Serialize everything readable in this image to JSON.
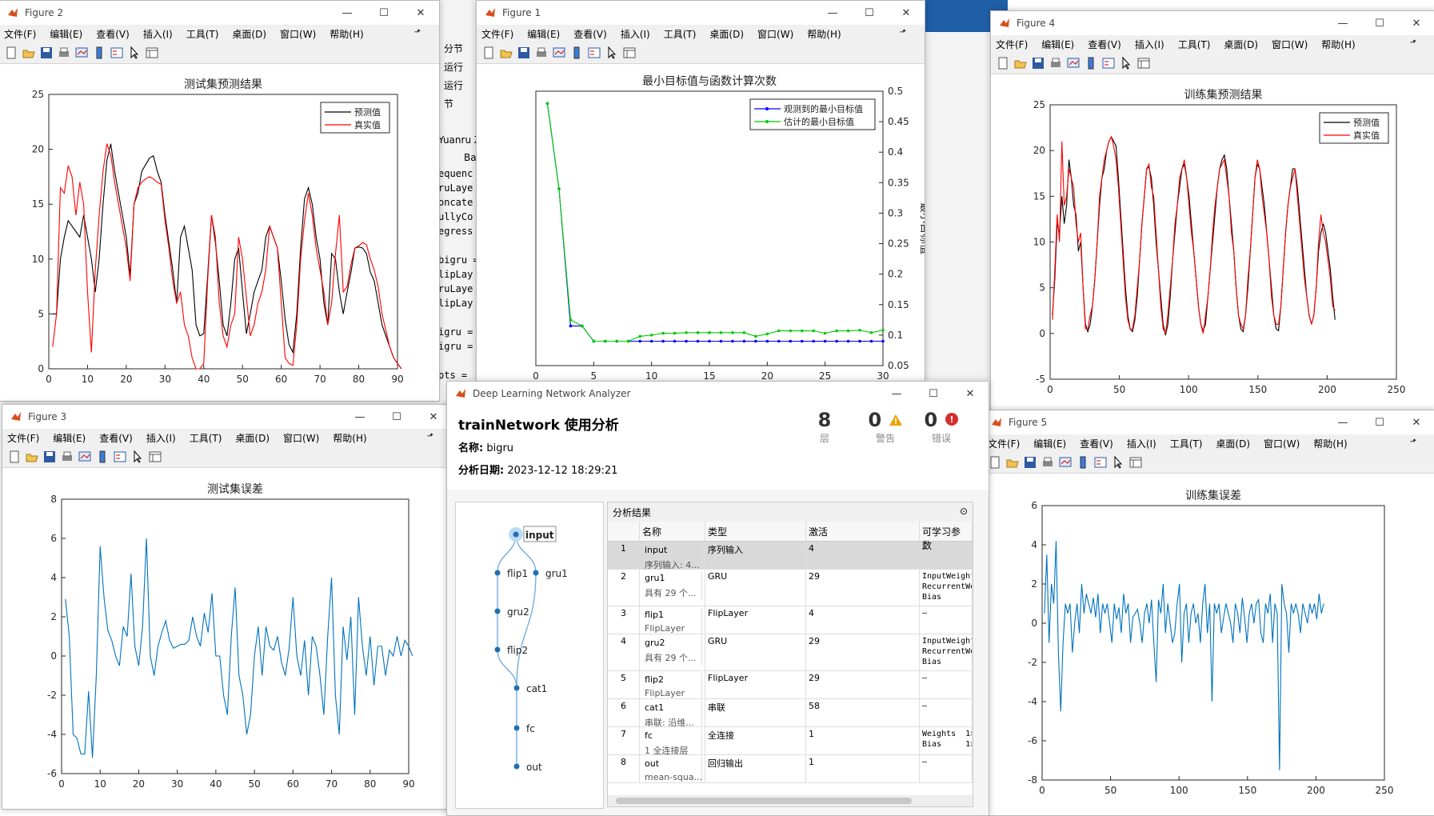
{
  "desktop": {
    "editor_side": [
      "分节",
      "运行",
      "运行",
      "节"
    ],
    "editor_tab": "Yuanru Z",
    "editor_tab2": "Ba",
    "editor_code": [
      "equenc",
      "ruLaye",
      "oncate",
      "ullyCo",
      "egress",
      "",
      "bigru =",
      "lipLay",
      "ruLaye",
      "lipLay",
      "",
      "igru =",
      "igru =",
      "",
      "pts ="
    ]
  },
  "menus": {
    "figure": [
      "文件(F)",
      "编辑(E)",
      "查看(V)",
      "插入(I)",
      "工具(T)",
      "桌面(D)",
      "窗口(W)",
      "帮助(H)"
    ]
  },
  "fig2": {
    "title": "Figure 2",
    "chart_data": {
      "type": "line",
      "title": "测试集预测结果",
      "xlim": [
        0,
        90
      ],
      "ylim": [
        0,
        25
      ],
      "xticks": [
        0,
        10,
        20,
        30,
        40,
        50,
        60,
        70,
        80,
        90
      ],
      "yticks": [
        0,
        5,
        10,
        15,
        20,
        25
      ],
      "legend": "top-right",
      "series": [
        {
          "name": "预测值",
          "color": "#000000",
          "values": [
            5,
            5,
            10,
            12,
            13.5,
            13,
            12.5,
            12,
            14,
            12,
            10,
            7,
            10,
            15,
            19,
            20.5,
            18,
            16,
            14,
            12,
            8.5,
            15,
            16,
            18,
            18.6,
            19.2,
            19.4,
            18,
            17,
            14,
            11.5,
            9,
            6,
            12,
            13,
            11,
            9,
            4,
            3,
            3.2,
            8.5,
            14,
            11.5,
            8,
            4,
            3,
            6,
            10,
            11,
            7,
            3.2,
            5,
            7,
            8,
            9,
            12,
            13,
            12,
            11,
            8,
            4.5,
            2.2,
            1.5,
            5,
            11,
            15.5,
            16.5,
            15,
            12,
            10,
            6,
            4,
            10.5,
            10,
            7,
            5,
            7,
            8.8,
            11,
            11.1,
            11,
            10.5,
            8.8,
            8,
            6,
            4,
            3,
            2,
            1,
            0.5,
            0
          ]
        },
        {
          "name": "真实值",
          "color": "#ff0000",
          "values": [
            2,
            5,
            16.5,
            16,
            18.5,
            17.5,
            14,
            17,
            15,
            7,
            1.5,
            9,
            14,
            18,
            20.5,
            19.5,
            17,
            15,
            13,
            11,
            8,
            15,
            16.5,
            17,
            17.3,
            17.5,
            17.3,
            17,
            16.8,
            13.5,
            11,
            8,
            6,
            7,
            4,
            3,
            1,
            0,
            0,
            0.5,
            8,
            14,
            12,
            6,
            3,
            2,
            4,
            5,
            12,
            10,
            6.5,
            3,
            4,
            6,
            7,
            9,
            13,
            12,
            11,
            6,
            1,
            0.5,
            0.3,
            4,
            10,
            13.5,
            16,
            14,
            11,
            9,
            7,
            4,
            6,
            10.5,
            14,
            7,
            7.5,
            9.5,
            11,
            11.2,
            11.5,
            11.3,
            10,
            9,
            7.5,
            5,
            3.5,
            2,
            1,
            0.5,
            0
          ]
        }
      ]
    }
  },
  "fig1": {
    "title": "Figure 1",
    "chart_data": {
      "type": "line",
      "title": "最小目标值与函数计算次数",
      "ylabel": "最小目标值",
      "xlim": [
        0,
        30
      ],
      "ylim": [
        0.05,
        0.5
      ],
      "xticks": [
        0,
        5,
        10,
        15,
        20,
        25,
        30
      ],
      "yticks": [
        0.05,
        0.1,
        0.15,
        0.2,
        0.25,
        0.3,
        0.35,
        0.4,
        0.45,
        0.5
      ],
      "legend": "top-right",
      "x": [
        1,
        2,
        3,
        4,
        5,
        6,
        7,
        8,
        9,
        10,
        11,
        12,
        13,
        14,
        15,
        16,
        17,
        18,
        19,
        20,
        21,
        22,
        23,
        24,
        25,
        26,
        27,
        28,
        29,
        30
      ],
      "series": [
        {
          "name": "观测到的最小目标值",
          "color": "#0000ff",
          "values": [
            0.48,
            0.34,
            0.115,
            0.115,
            0.09,
            0.09,
            0.09,
            0.09,
            0.09,
            0.09,
            0.09,
            0.09,
            0.09,
            0.09,
            0.09,
            0.09,
            0.09,
            0.09,
            0.09,
            0.09,
            0.09,
            0.09,
            0.09,
            0.09,
            0.09,
            0.09,
            0.09,
            0.09,
            0.09,
            0.09
          ]
        },
        {
          "name": "估计的最小目标值",
          "color": "#00cc00",
          "values": [
            0.48,
            0.34,
            0.125,
            0.115,
            0.09,
            0.09,
            0.09,
            0.09,
            0.098,
            0.1,
            0.103,
            0.103,
            0.104,
            0.104,
            0.104,
            0.104,
            0.104,
            0.104,
            0.098,
            0.102,
            0.107,
            0.107,
            0.107,
            0.107,
            0.103,
            0.107,
            0.107,
            0.108,
            0.104,
            0.108
          ]
        }
      ]
    }
  },
  "fig4": {
    "title": "Figure 4",
    "chart_data": {
      "type": "line",
      "title": "训练集预测结果",
      "xlim": [
        0,
        250
      ],
      "ylim": [
        -5,
        25
      ],
      "xticks": [
        0,
        50,
        100,
        150,
        200,
        250
      ],
      "yticks": [
        -5,
        0,
        5,
        10,
        15,
        20,
        25
      ],
      "legend": "top-right",
      "series": [
        {
          "name": "预测值",
          "color": "#000000",
          "values": [
            2,
            6,
            12,
            11,
            15,
            12,
            14,
            19,
            17,
            14,
            13,
            9,
            10,
            5,
            1,
            0.2,
            1,
            3,
            6,
            10,
            14,
            17,
            18,
            20,
            21,
            21.5,
            21,
            20.5,
            17,
            13,
            9,
            5,
            2,
            0.5,
            0.2,
            1.5,
            4,
            8,
            12,
            15,
            18,
            18.2,
            17,
            14,
            10,
            7,
            4,
            1,
            -0.2,
            1,
            4,
            8,
            11,
            14,
            16,
            18,
            18.5,
            17,
            15,
            12,
            9,
            6,
            3,
            1,
            0.3,
            1,
            4,
            7,
            10,
            13,
            16,
            18,
            19,
            19.5,
            18,
            15,
            12,
            9,
            5,
            2,
            0.5,
            0.2,
            2,
            5,
            9,
            13,
            17,
            18.5,
            18,
            16,
            14,
            11,
            8,
            5,
            2,
            0.5,
            0.3,
            3,
            7,
            11,
            14,
            16,
            18,
            18,
            16,
            13,
            10,
            7,
            4,
            2,
            1,
            2,
            5,
            9,
            11,
            12,
            11,
            9,
            7,
            4,
            1.5
          ]
        },
        {
          "name": "真实值",
          "color": "#ff0000",
          "values": [
            1.5,
            7,
            13,
            10,
            21,
            14,
            15,
            18,
            17,
            16,
            12,
            10,
            11,
            5,
            0.5,
            0.5,
            2,
            3,
            6,
            10,
            15,
            17,
            19,
            20,
            21,
            21.5,
            20.5,
            19,
            16,
            12,
            8,
            4,
            1.5,
            0.5,
            0.5,
            2,
            5,
            8,
            12,
            15,
            18,
            18.5,
            16,
            15,
            11,
            7,
            3,
            0.5,
            0,
            2,
            5,
            8,
            12,
            14,
            17,
            18,
            19,
            17,
            14,
            11,
            9,
            6,
            3,
            1,
            0,
            2,
            4,
            7,
            11,
            14,
            16,
            18,
            18.5,
            19,
            17,
            15,
            11,
            9,
            5,
            2,
            1,
            0.5,
            2,
            6,
            9,
            13,
            17,
            19,
            18,
            15,
            13,
            11,
            8,
            4,
            2,
            1,
            1,
            3,
            7,
            11,
            14,
            16,
            17,
            18,
            15,
            12,
            9,
            6,
            4,
            2,
            1,
            2,
            5,
            10,
            13,
            11,
            10,
            8,
            6,
            3,
            2.5
          ]
        }
      ]
    }
  },
  "fig3": {
    "title": "Figure 3",
    "chart_data": {
      "type": "line",
      "title": "测试集误差",
      "xlim": [
        0,
        90
      ],
      "ylim": [
        -6,
        8
      ],
      "xticks": [
        0,
        10,
        20,
        30,
        40,
        50,
        60,
        70,
        80,
        90
      ],
      "yticks": [
        -6,
        -4,
        -2,
        0,
        2,
        4,
        6,
        8
      ],
      "series": [
        {
          "name": "",
          "color": "#0072bd",
          "values": [
            2.9,
            1,
            -4,
            -4.2,
            -5,
            -5,
            -1.8,
            -5.2,
            -1,
            5.6,
            3,
            1.3,
            0.8,
            0,
            -0.5,
            1.5,
            1,
            4.2,
            0.5,
            -0.5,
            1.5,
            6,
            0,
            -1,
            0.5,
            1.2,
            1.8,
            0.8,
            0.4,
            0.5,
            0.6,
            0.6,
            0.8,
            2,
            1,
            0.5,
            2.2,
            1.2,
            3.2,
            0,
            0,
            -2,
            -3,
            1,
            3.5,
            -1,
            -2,
            -4,
            -3,
            0,
            1.5,
            -1,
            1.5,
            0.5,
            0.3,
            1,
            -0.3,
            -1,
            0.4,
            3,
            0,
            -1,
            0.8,
            -2,
            1,
            0.5,
            -1,
            -3,
            1,
            4,
            -2,
            -4,
            1.5,
            -0.2,
            2,
            -3,
            3,
            0.5,
            -1,
            1,
            -1.5,
            0.5,
            0.5,
            -1,
            0.3,
            0,
            1,
            0,
            0.8,
            0.5,
            0
          ]
        }
      ]
    }
  },
  "fig5": {
    "title": "Figure 5",
    "chart_data": {
      "type": "line",
      "title": "训练集误差",
      "xlim": [
        0,
        250
      ],
      "ylim": [
        -8,
        6
      ],
      "xticks": [
        0,
        50,
        100,
        150,
        200,
        250
      ],
      "yticks": [
        -8,
        -6,
        -4,
        -2,
        0,
        2,
        4,
        6
      ],
      "series": [
        {
          "name": "",
          "color": "#0072bd",
          "values": [
            0.5,
            3.5,
            -1,
            2,
            1,
            4.2,
            -1.5,
            -4.5,
            -1,
            1,
            0.5,
            1,
            -1.5,
            0,
            1,
            -0.5,
            2,
            0.5,
            1.5,
            1,
            0.5,
            1.3,
            0.3,
            1.5,
            -0.5,
            1,
            0.5,
            1,
            0,
            -1,
            1,
            0.2,
            0.8,
            -0.5,
            1.5,
            0.5,
            1,
            -1,
            0.3,
            0.5,
            0.7,
            0,
            -1,
            0.5,
            1,
            0,
            1.2,
            -1,
            -3,
            1.2,
            0.5,
            2,
            -0.5,
            1,
            0,
            -1,
            -0.5,
            1,
            2,
            -2,
            0.5,
            1,
            -1,
            0.5,
            1,
            0,
            0.5,
            -1,
            1,
            2,
            -0.5,
            1,
            -4,
            1,
            0.5,
            1,
            -0.5,
            0.3,
            1,
            0.5,
            0,
            -1,
            1,
            0.5,
            -0.5,
            1.3,
            0.3,
            -1,
            0.5,
            1,
            0,
            1,
            1.2,
            -0.5,
            -1,
            1,
            0.5,
            1.5,
            -1,
            1,
            0.5,
            -7.5,
            2,
            1,
            0.5,
            -1.5,
            1,
            0.5,
            1,
            0.5,
            -0.5,
            1,
            0.5,
            0,
            1,
            0.5,
            1,
            0.2,
            1.5,
            0.5,
            1
          ]
        }
      ]
    }
  },
  "dna": {
    "window_title": "Deep Learning Network Analyzer",
    "heading": "trainNetwork 使用分析",
    "name_label": "名称:",
    "name_value": "bigru",
    "date_label": "分析日期:",
    "date_value": "2023-12-12 18:29:21",
    "stats": [
      {
        "value": "8",
        "label": "层"
      },
      {
        "value": "0",
        "label": "警告"
      },
      {
        "value": "0",
        "label": "错误"
      }
    ],
    "results_title": "分析结果",
    "columns": [
      "",
      "名称",
      "类型",
      "激活",
      "可学习参数"
    ],
    "rows": [
      {
        "idx": "1",
        "name": "input",
        "sub": "序列输入: 4...",
        "type": "序列输入",
        "act": "4",
        "params": "–"
      },
      {
        "idx": "2",
        "name": "gru1",
        "sub": "具有 29 个...",
        "type": "GRU",
        "act": "29",
        "params": "InputWeight\nRecurrentWe\nBias"
      },
      {
        "idx": "3",
        "name": "flip1",
        "sub": "FlipLayer",
        "type": "FlipLayer",
        "act": "4",
        "params": "–"
      },
      {
        "idx": "4",
        "name": "gru2",
        "sub": "具有 29 个...",
        "type": "GRU",
        "act": "29",
        "params": "InputWeight\nRecurrentWe\nBias"
      },
      {
        "idx": "5",
        "name": "flip2",
        "sub": "FlipLayer",
        "type": "FlipLayer",
        "act": "29",
        "params": "–"
      },
      {
        "idx": "6",
        "name": "cat1",
        "sub": "串联: 沿维...",
        "type": "串联",
        "act": "58",
        "params": "–"
      },
      {
        "idx": "7",
        "name": "fc",
        "sub": "1 全连接层",
        "type": "全连接",
        "act": "1",
        "params": "Weights  1>\nBias     1>"
      },
      {
        "idx": "8",
        "name": "out",
        "sub": "mean-squa...",
        "type": "回归输出",
        "act": "1",
        "params": "–"
      }
    ],
    "graph_nodes": [
      "input",
      "flip1",
      "gru1",
      "gru2",
      "flip2",
      "cat1",
      "fc",
      "out"
    ]
  }
}
